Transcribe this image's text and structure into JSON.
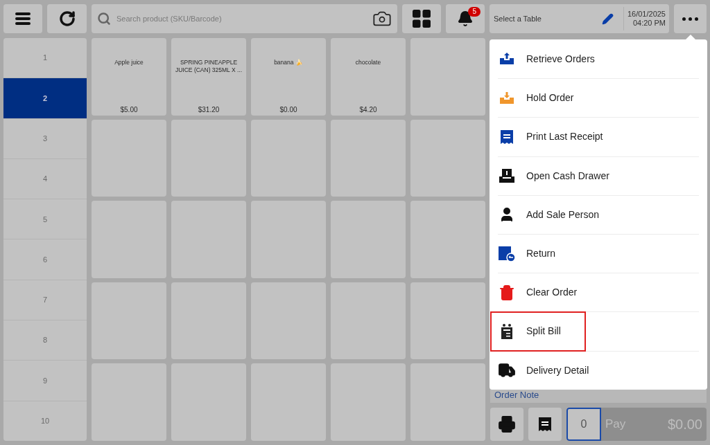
{
  "toolbar": {
    "search": {
      "placeholder": "Search product (SKU/Barcode)"
    },
    "notifications": {
      "count": "5"
    },
    "table": {
      "label": "Select a Table"
    },
    "datetime": {
      "date": "16/01/2025",
      "time": "04:20 PM"
    }
  },
  "pages": [
    {
      "label": "1",
      "selected": false
    },
    {
      "label": "2",
      "selected": true
    },
    {
      "label": "3",
      "selected": false
    },
    {
      "label": "4",
      "selected": false
    },
    {
      "label": "5",
      "selected": false
    },
    {
      "label": "6",
      "selected": false
    },
    {
      "label": "7",
      "selected": false
    },
    {
      "label": "8",
      "selected": false
    },
    {
      "label": "9",
      "selected": false
    },
    {
      "label": "10",
      "selected": false
    }
  ],
  "products": [
    {
      "name": "Apple juice",
      "price": "$5.00"
    },
    {
      "name": "SPRING PINEAPPLE JUICE (CAN) 325ML X ...",
      "price": "$31.20"
    },
    {
      "name": "banana 🍌",
      "price": "$0.00"
    },
    {
      "name": "chocolate",
      "price": "$4.20"
    }
  ],
  "menu": {
    "items": [
      {
        "label": "Retrieve Orders",
        "highlighted": false
      },
      {
        "label": "Hold Order",
        "highlighted": false
      },
      {
        "label": "Print Last Receipt",
        "highlighted": false
      },
      {
        "label": "Open Cash Drawer",
        "highlighted": false
      },
      {
        "label": "Add Sale Person",
        "highlighted": false
      },
      {
        "label": "Return",
        "highlighted": false
      },
      {
        "label": "Clear Order",
        "highlighted": false
      },
      {
        "label": "Split Bill",
        "highlighted": true
      },
      {
        "label": "Delivery Detail",
        "highlighted": false
      }
    ]
  },
  "order": {
    "note": "Order Note",
    "quantity": "0",
    "pay_label": "Pay",
    "total": "$0.00"
  }
}
